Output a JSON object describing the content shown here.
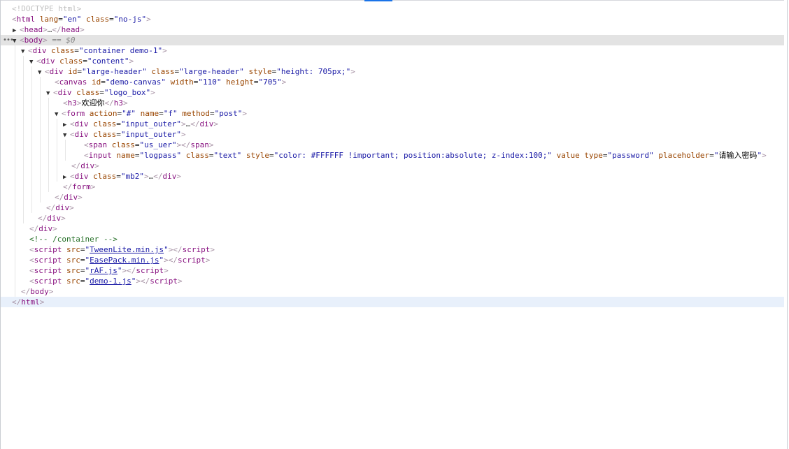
{
  "dom": {
    "doctype": "<!DOCTYPE html>",
    "html_attrs": {
      "lang": "en",
      "class": "no-js"
    },
    "head_collapsed": "…",
    "body_selected_marker": "== $0",
    "container_class": "container demo-1",
    "content_class": "content",
    "large_header": {
      "id": "large-header",
      "class": "large-header",
      "style": "height: 705px;"
    },
    "canvas": {
      "id": "demo-canvas",
      "width": "110",
      "height": "705"
    },
    "logo_box_class": "logo_box",
    "h3_text": "欢迎你",
    "form": {
      "action": "#",
      "name": "f",
      "method": "post"
    },
    "input_outer_class": "input_outer",
    "collapsed_ellipsis": "…",
    "span_class": "us_uer",
    "input": {
      "name": "logpass",
      "class": "text",
      "style": "color: #FFFFFF !important; position:absolute; z-index:100;",
      "value": "",
      "type": "password",
      "placeholder": "请输入密码"
    },
    "mb2_class": "mb2",
    "comment": "<!-- /container -->",
    "scripts": [
      "TweenLite.min.js",
      "EasePack.min.js",
      "rAF.js",
      "demo-1.js"
    ]
  },
  "colors": {
    "tag": "#881280",
    "attr_name": "#994500",
    "attr_value": "#1a1aa6",
    "selected_row": "#e3e3e3",
    "hover_row": "#e8f0fb"
  }
}
